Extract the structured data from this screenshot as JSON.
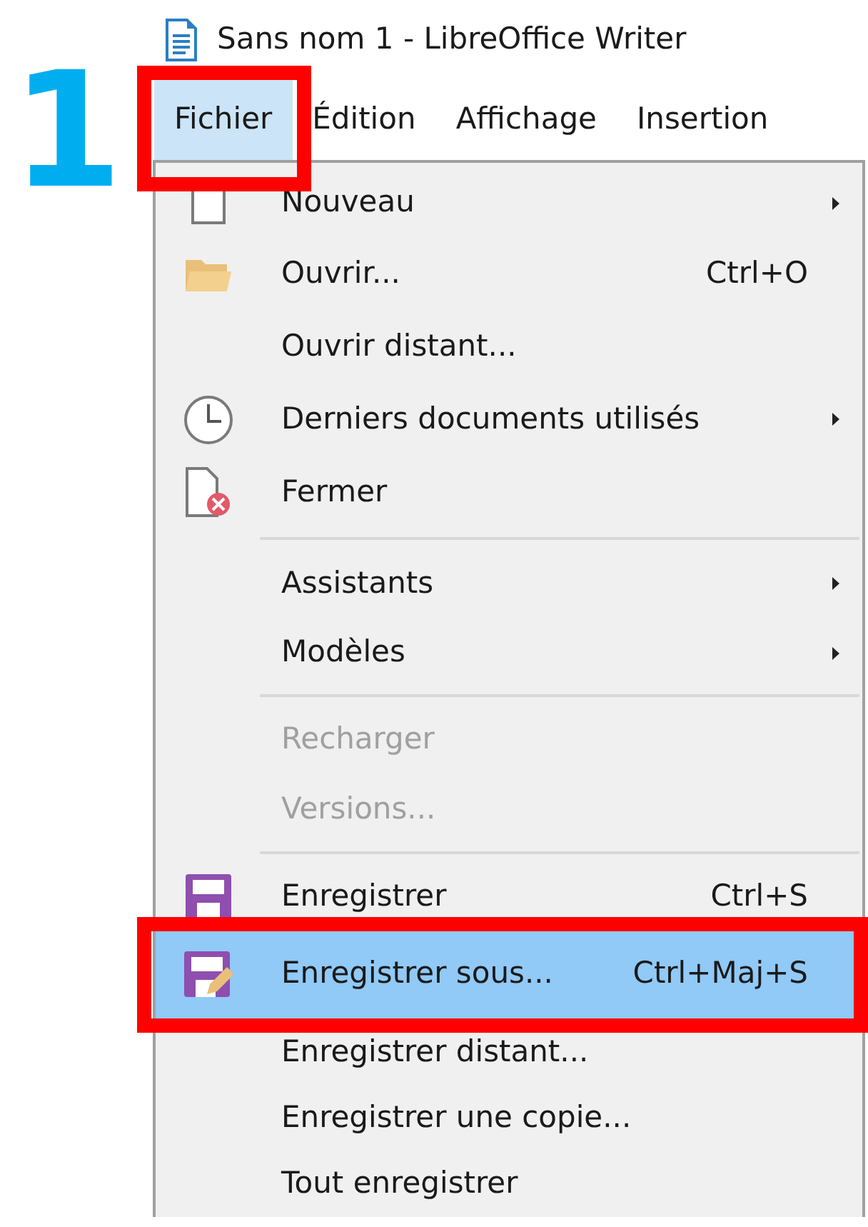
{
  "step_label": "1",
  "window": {
    "title": "Sans nom 1 - LibreOffice Writer"
  },
  "menubar": [
    {
      "label": "Fichier",
      "selected": true,
      "framed": true
    },
    {
      "label": "Édition",
      "selected": false,
      "framed": false
    },
    {
      "label": "Affichage",
      "selected": false,
      "framed": false
    },
    {
      "label": "Insertion",
      "selected": false,
      "framed": false
    }
  ],
  "menu": [
    {
      "kind": "item",
      "label": "Nouveau",
      "submenu": true,
      "disabled": false,
      "selected": false,
      "framed": false
    },
    {
      "kind": "item",
      "label": "Ouvrir...",
      "shortcut": "Ctrl+O",
      "submenu": false,
      "disabled": false,
      "selected": false,
      "framed": false
    },
    {
      "kind": "item",
      "label": "Ouvrir distant...",
      "submenu": false,
      "disabled": false,
      "selected": false,
      "framed": false
    },
    {
      "kind": "item",
      "label": "Derniers documents utilisés",
      "submenu": true,
      "disabled": false,
      "selected": false,
      "framed": false
    },
    {
      "kind": "item",
      "label": "Fermer",
      "submenu": false,
      "disabled": false,
      "selected": false,
      "framed": false
    },
    {
      "kind": "separator"
    },
    {
      "kind": "item",
      "label": "Assistants",
      "submenu": true,
      "disabled": false,
      "selected": false,
      "framed": false
    },
    {
      "kind": "item",
      "label": "Modèles",
      "submenu": true,
      "disabled": false,
      "selected": false,
      "framed": false
    },
    {
      "kind": "separator"
    },
    {
      "kind": "item",
      "label": "Recharger",
      "submenu": false,
      "disabled": true,
      "selected": false,
      "framed": false
    },
    {
      "kind": "item",
      "label": "Versions...",
      "submenu": false,
      "disabled": true,
      "selected": false,
      "framed": false
    },
    {
      "kind": "separator"
    },
    {
      "kind": "item",
      "label": "Enregistrer",
      "shortcut": "Ctrl+S",
      "submenu": false,
      "disabled": false,
      "selected": false,
      "framed": false
    },
    {
      "kind": "item",
      "label": "Enregistrer sous...",
      "shortcut": "Ctrl+Maj+S",
      "submenu": false,
      "disabled": false,
      "selected": true,
      "framed": true
    },
    {
      "kind": "item",
      "label": "Enregistrer distant...",
      "submenu": false,
      "disabled": false,
      "selected": false,
      "framed": false
    },
    {
      "kind": "item",
      "label": "Enregistrer une copie...",
      "submenu": false,
      "disabled": false,
      "selected": false,
      "framed": false
    },
    {
      "kind": "item",
      "label": "Tout enregistrer",
      "submenu": false,
      "disabled": false,
      "selected": false,
      "framed": false
    }
  ]
}
